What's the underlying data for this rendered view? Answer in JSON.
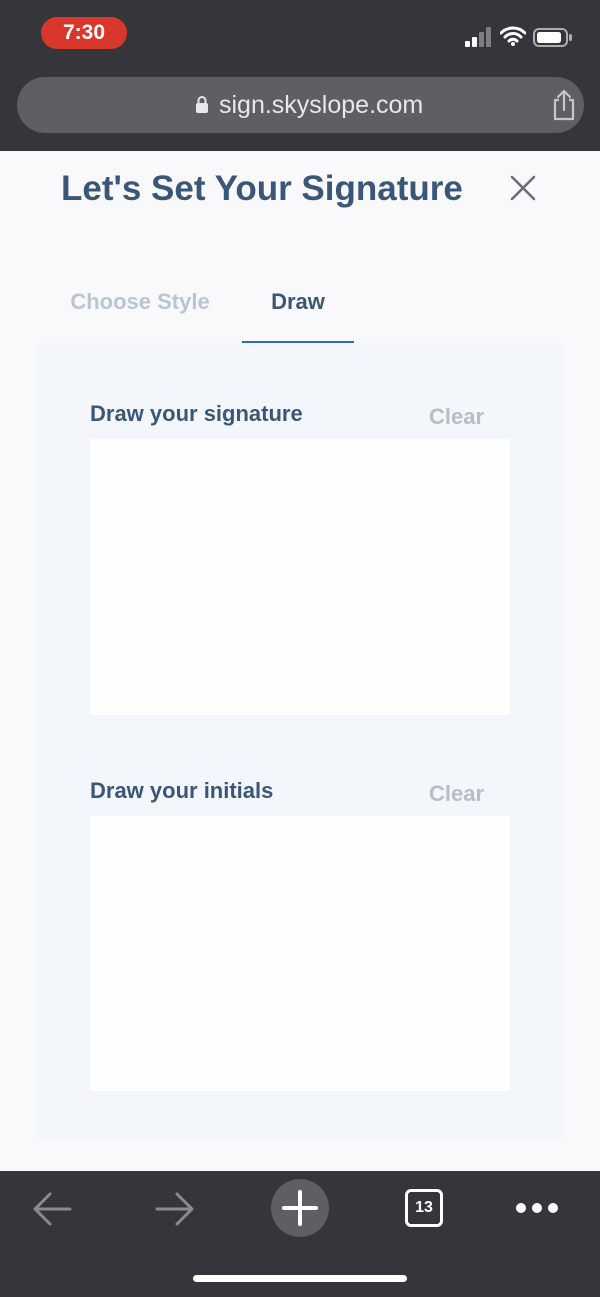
{
  "status_bar": {
    "time": "7:30",
    "icons": [
      "cellular-signal-icon",
      "wifi-icon",
      "battery-icon"
    ],
    "time_pill_color": "#d9362c"
  },
  "browser": {
    "url": "sign.skyslope.com",
    "icons": [
      "lock-icon",
      "share-icon"
    ]
  },
  "modal": {
    "title": "Let's Set Your Signature",
    "close_icon": "close-icon",
    "tabs": [
      {
        "label": "Choose Style",
        "active": false
      },
      {
        "label": "Draw",
        "active": true
      }
    ],
    "signature": {
      "label": "Draw your signature",
      "clear_label": "Clear"
    },
    "initials": {
      "label": "Draw your initials",
      "clear_label": "Clear"
    }
  },
  "toolbar": {
    "tab_count": "13",
    "icons": [
      "back-arrow-icon",
      "forward-arrow-icon",
      "plus-icon",
      "tabs-icon",
      "more-icon"
    ]
  },
  "colors": {
    "title": "#3b5777",
    "accent": "#2a6bc4",
    "inactive_tab": "#b9c5d3",
    "clear_text": "#b9bec6",
    "chrome": "#35363a"
  }
}
